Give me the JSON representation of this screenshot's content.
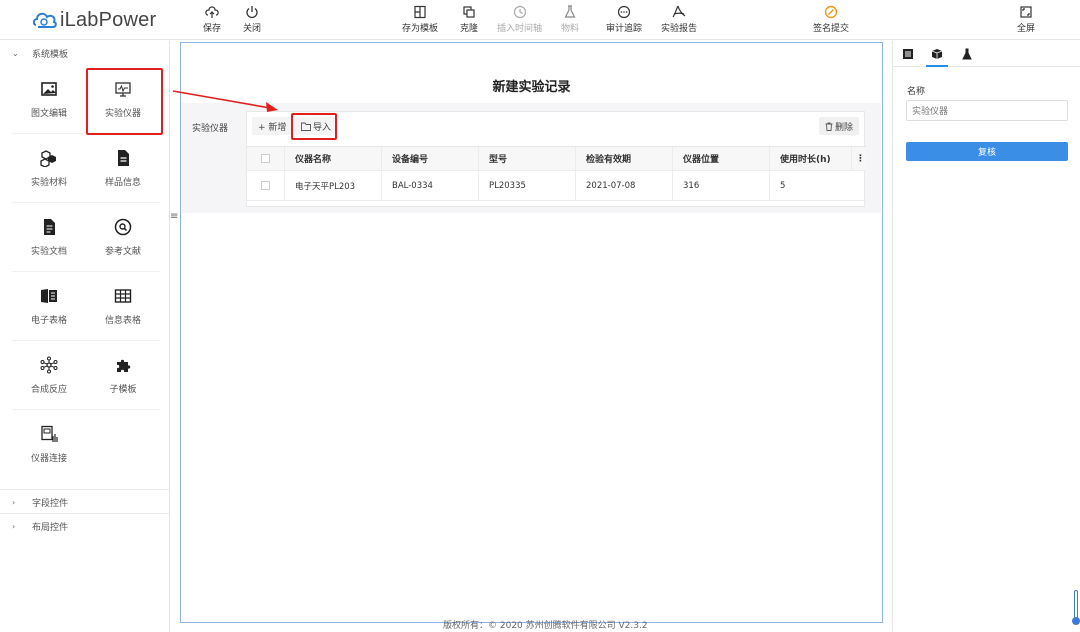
{
  "app": {
    "logo_text": "iLabPower"
  },
  "toolbar": {
    "save": "保存",
    "close": "关闭",
    "save_template": "存为模板",
    "clone": "克隆",
    "insert_timeline": "插入时间轴",
    "material": "物料",
    "audit_trace": "审计追踪",
    "experiment_report": "实验报告",
    "sign_submit": "签名提交",
    "fullscreen": "全屏"
  },
  "sidebar": {
    "system_templates": "系统模板",
    "items": [
      {
        "label": "图文编辑",
        "icon": "image-text-icon"
      },
      {
        "label": "实验仪器",
        "icon": "instrument-icon"
      },
      {
        "label": "实验材料",
        "icon": "material-icon"
      },
      {
        "label": "样品信息",
        "icon": "sample-doc-icon"
      },
      {
        "label": "实验文档",
        "icon": "document-icon"
      },
      {
        "label": "参考文献",
        "icon": "reference-icon"
      },
      {
        "label": "电子表格",
        "icon": "spreadsheet-icon"
      },
      {
        "label": "信息表格",
        "icon": "table-icon"
      },
      {
        "label": "合成反应",
        "icon": "reaction-icon"
      },
      {
        "label": "子模板",
        "icon": "puzzle-icon"
      },
      {
        "label": "仪器连接",
        "icon": "instrument-link-icon"
      }
    ],
    "field_controls": "字段控件",
    "layout_controls": "布局控件"
  },
  "editor": {
    "title": "新建实验记录",
    "block_label": "实验仪器",
    "add_label": "+ 新增",
    "import_label": "导入",
    "delete_label": "删除",
    "columns": [
      "仪器名称",
      "设备编号",
      "型号",
      "检验有效期",
      "仪器位置",
      "使用时长(h)"
    ],
    "rows": [
      [
        "电子天平PL203",
        "BAL-0334",
        "PL20335",
        "2021-07-08",
        "316",
        "5"
      ]
    ]
  },
  "properties": {
    "name_label": "名称",
    "name_value": "实验仪器",
    "review_button": "复核"
  },
  "footer": {
    "copyright": "版权所有：© 2020 苏州创腾软件有限公司   V2.3.2"
  },
  "colors": {
    "accent": "#3a8ee6",
    "highlight": "#e02020",
    "canvas_border": "#8fb5e6"
  }
}
